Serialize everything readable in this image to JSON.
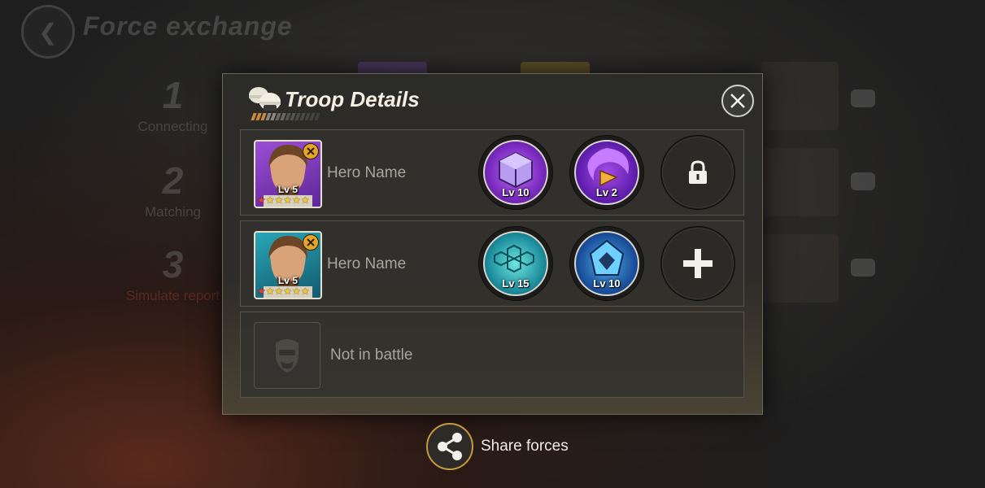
{
  "background": {
    "screen_title": "Force exchange",
    "steps": [
      {
        "number": "1",
        "label": "Connecting"
      },
      {
        "number": "2",
        "label": "Matching"
      },
      {
        "number": "3",
        "label": "Simulate report"
      }
    ]
  },
  "modal": {
    "title": "Troop Details",
    "rows": [
      {
        "hero_name": "Hero Name",
        "hero_level": "Lv 5",
        "portrait_color": "purple",
        "slots": [
          {
            "level": "Lv 10",
            "icon": "purple-cube-relic-icon"
          },
          {
            "level": "Lv 2",
            "icon": "purple-vortex-relic-icon"
          },
          {
            "state": "locked",
            "icon": "padlock-icon"
          }
        ]
      },
      {
        "hero_name": "Hero Name",
        "hero_level": "Lv 5",
        "portrait_color": "teal",
        "slots": [
          {
            "level": "Lv 15",
            "icon": "teal-hex-shield-relic-icon"
          },
          {
            "level": "Lv 10",
            "icon": "blue-crystal-relic-icon"
          },
          {
            "state": "add",
            "icon": "plus-icon"
          }
        ]
      },
      {
        "empty": true,
        "label": "Not in battle",
        "icon": "empty-soldier-icon"
      }
    ]
  },
  "share": {
    "label": "Share forces",
    "icon": "share-icon"
  },
  "colors": {
    "accent_gold": "#c89a3c",
    "title_text": "#f4efe2"
  }
}
